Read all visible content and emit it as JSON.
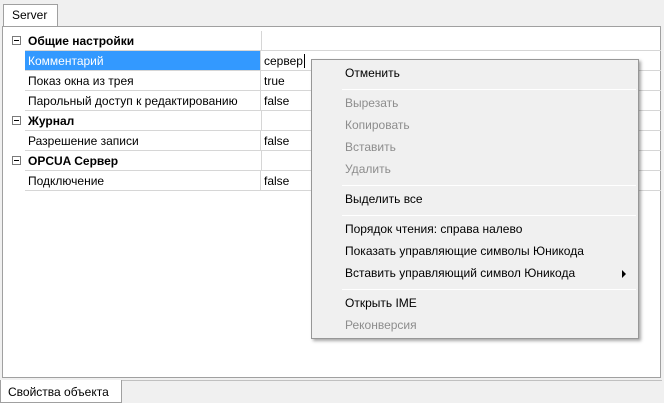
{
  "tabs": {
    "top": "Server",
    "bottom": "Свойства объекта"
  },
  "grid": {
    "categories": [
      {
        "label": "Общие настройки"
      },
      {
        "label": "Журнал"
      },
      {
        "label": "OPCUA Сервер"
      }
    ],
    "properties": [
      {
        "name": "Комментарий",
        "value": "сервер",
        "selected": true
      },
      {
        "name": "Показ окна из трея",
        "value": "true"
      },
      {
        "name": "Парольный доступ к редактированию",
        "value": "false"
      },
      {
        "name": "Разрешение записи",
        "value": "false"
      },
      {
        "name": "Подключение",
        "value": "false"
      }
    ]
  },
  "context_menu": {
    "items": [
      {
        "label": "Отменить",
        "enabled": true
      },
      {
        "label": "Вырезать",
        "enabled": false
      },
      {
        "label": "Копировать",
        "enabled": false
      },
      {
        "label": "Вставить",
        "enabled": false
      },
      {
        "label": "Удалить",
        "enabled": false
      },
      {
        "label": "Выделить все",
        "enabled": true
      },
      {
        "label": "Порядок чтения: справа налево",
        "enabled": true
      },
      {
        "label": "Показать управляющие символы Юникода",
        "enabled": true
      },
      {
        "label": "Вставить управляющий символ Юникода",
        "enabled": true,
        "submenu": true
      },
      {
        "label": "Открыть IME",
        "enabled": true
      },
      {
        "label": "Реконверсия",
        "enabled": false
      }
    ]
  },
  "colors": {
    "selection": "#3399ff",
    "menu_bg": "#f0f0f0",
    "disabled_text": "#8d8d8d"
  }
}
